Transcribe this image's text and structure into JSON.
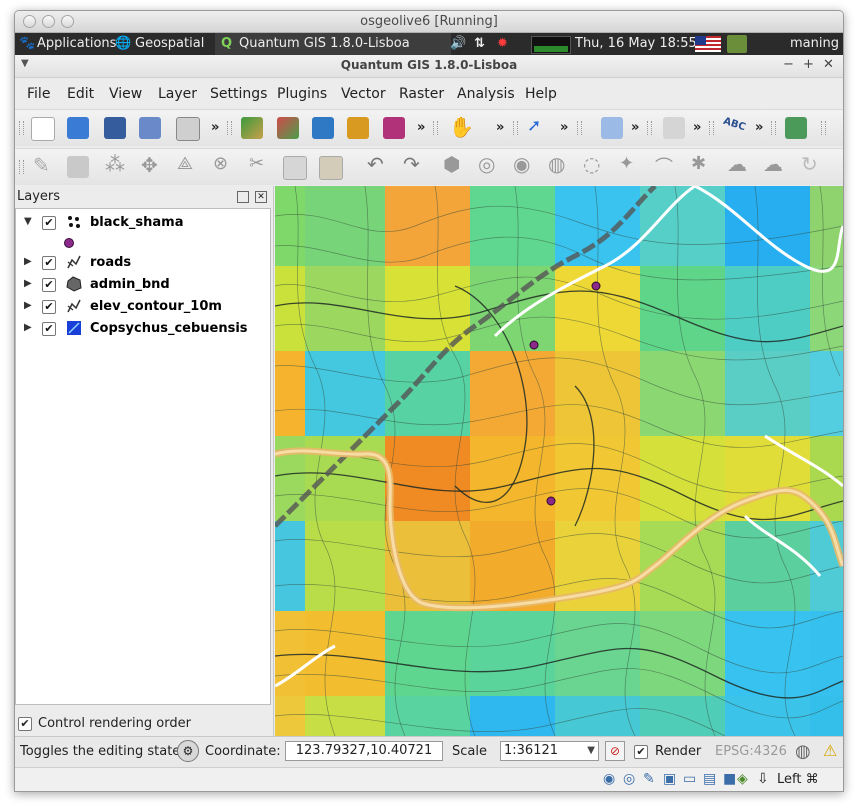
{
  "vbox": {
    "title": "osgeolive6 [Running]"
  },
  "panel": {
    "applications": "Applications",
    "geospatial": "Geospatial",
    "task": "Quantum GIS 1.8.0-Lisboa",
    "datetime": "Thu, 16 May  18:55",
    "user": "maning"
  },
  "app": {
    "title": "Quantum GIS 1.8.0-Lisboa"
  },
  "menu": [
    "File",
    "Edit",
    "View",
    "Layer",
    "Settings",
    "Plugins",
    "Vector",
    "Raster",
    "Analysis",
    "Help"
  ],
  "toolbar": {
    "more": "»"
  },
  "layers": {
    "title": "Layers",
    "items": [
      {
        "name": "black_shama",
        "icon": "point-layer-icon",
        "expanded": true,
        "checked": true
      },
      {
        "name": "roads",
        "icon": "line-layer-icon",
        "expanded": false,
        "checked": true
      },
      {
        "name": "admin_bnd",
        "icon": "polygon-layer-icon",
        "expanded": false,
        "checked": true
      },
      {
        "name": "elev_contour_10m",
        "icon": "line-layer-icon",
        "expanded": false,
        "checked": true
      },
      {
        "name": "Copsychus_cebuensis",
        "icon": "raster-layer-icon",
        "expanded": false,
        "checked": true
      }
    ],
    "control_rendering_order": "Control rendering order"
  },
  "status": {
    "message": "Toggles the editing state o",
    "coordinate_label": "Coordinate:",
    "coordinate_value": "123.79327,10.40721",
    "scale_label": "Scale",
    "scale_value": "1:36121",
    "render_label": "Render",
    "crs": "EPSG:4326"
  },
  "host": {
    "key": "Left ⌘"
  },
  "colors": {
    "panel": "#2b2b2b",
    "raster_high": "#f08c1c",
    "raster_low": "#28c6f0",
    "road": "#f4d08a",
    "point": "#8b2a8b"
  }
}
